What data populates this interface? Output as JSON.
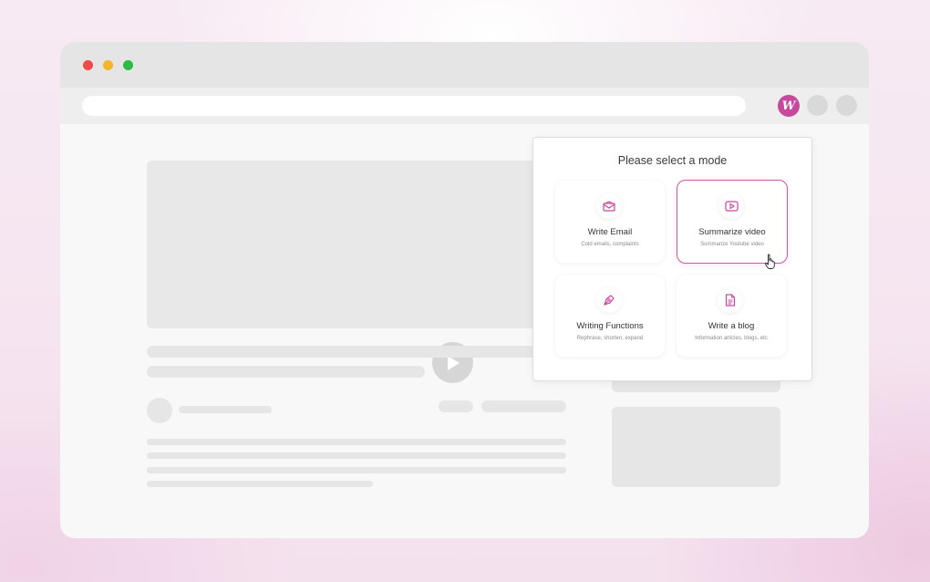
{
  "browser": {
    "extension_icon": "writer-logo-icon",
    "extension_letter": "W",
    "extension_color": "#c8489e"
  },
  "popup": {
    "title": "Please select a mode",
    "accent_color": "#cc5aa8",
    "modes": [
      {
        "label": "Write Email",
        "sub": "Cold emails, complaints",
        "icon": "envelope-icon",
        "selected": false
      },
      {
        "label": "Summarize video",
        "sub": "Summarize Youtube video",
        "icon": "video-play-icon",
        "selected": true
      },
      {
        "label": "Writing Functions",
        "sub": "Rephrase, shorten, expand",
        "icon": "pen-nib-icon",
        "selected": false
      },
      {
        "label": "Write a blog",
        "sub": "Information articles, blogs, etc",
        "icon": "document-icon",
        "selected": false
      }
    ]
  }
}
